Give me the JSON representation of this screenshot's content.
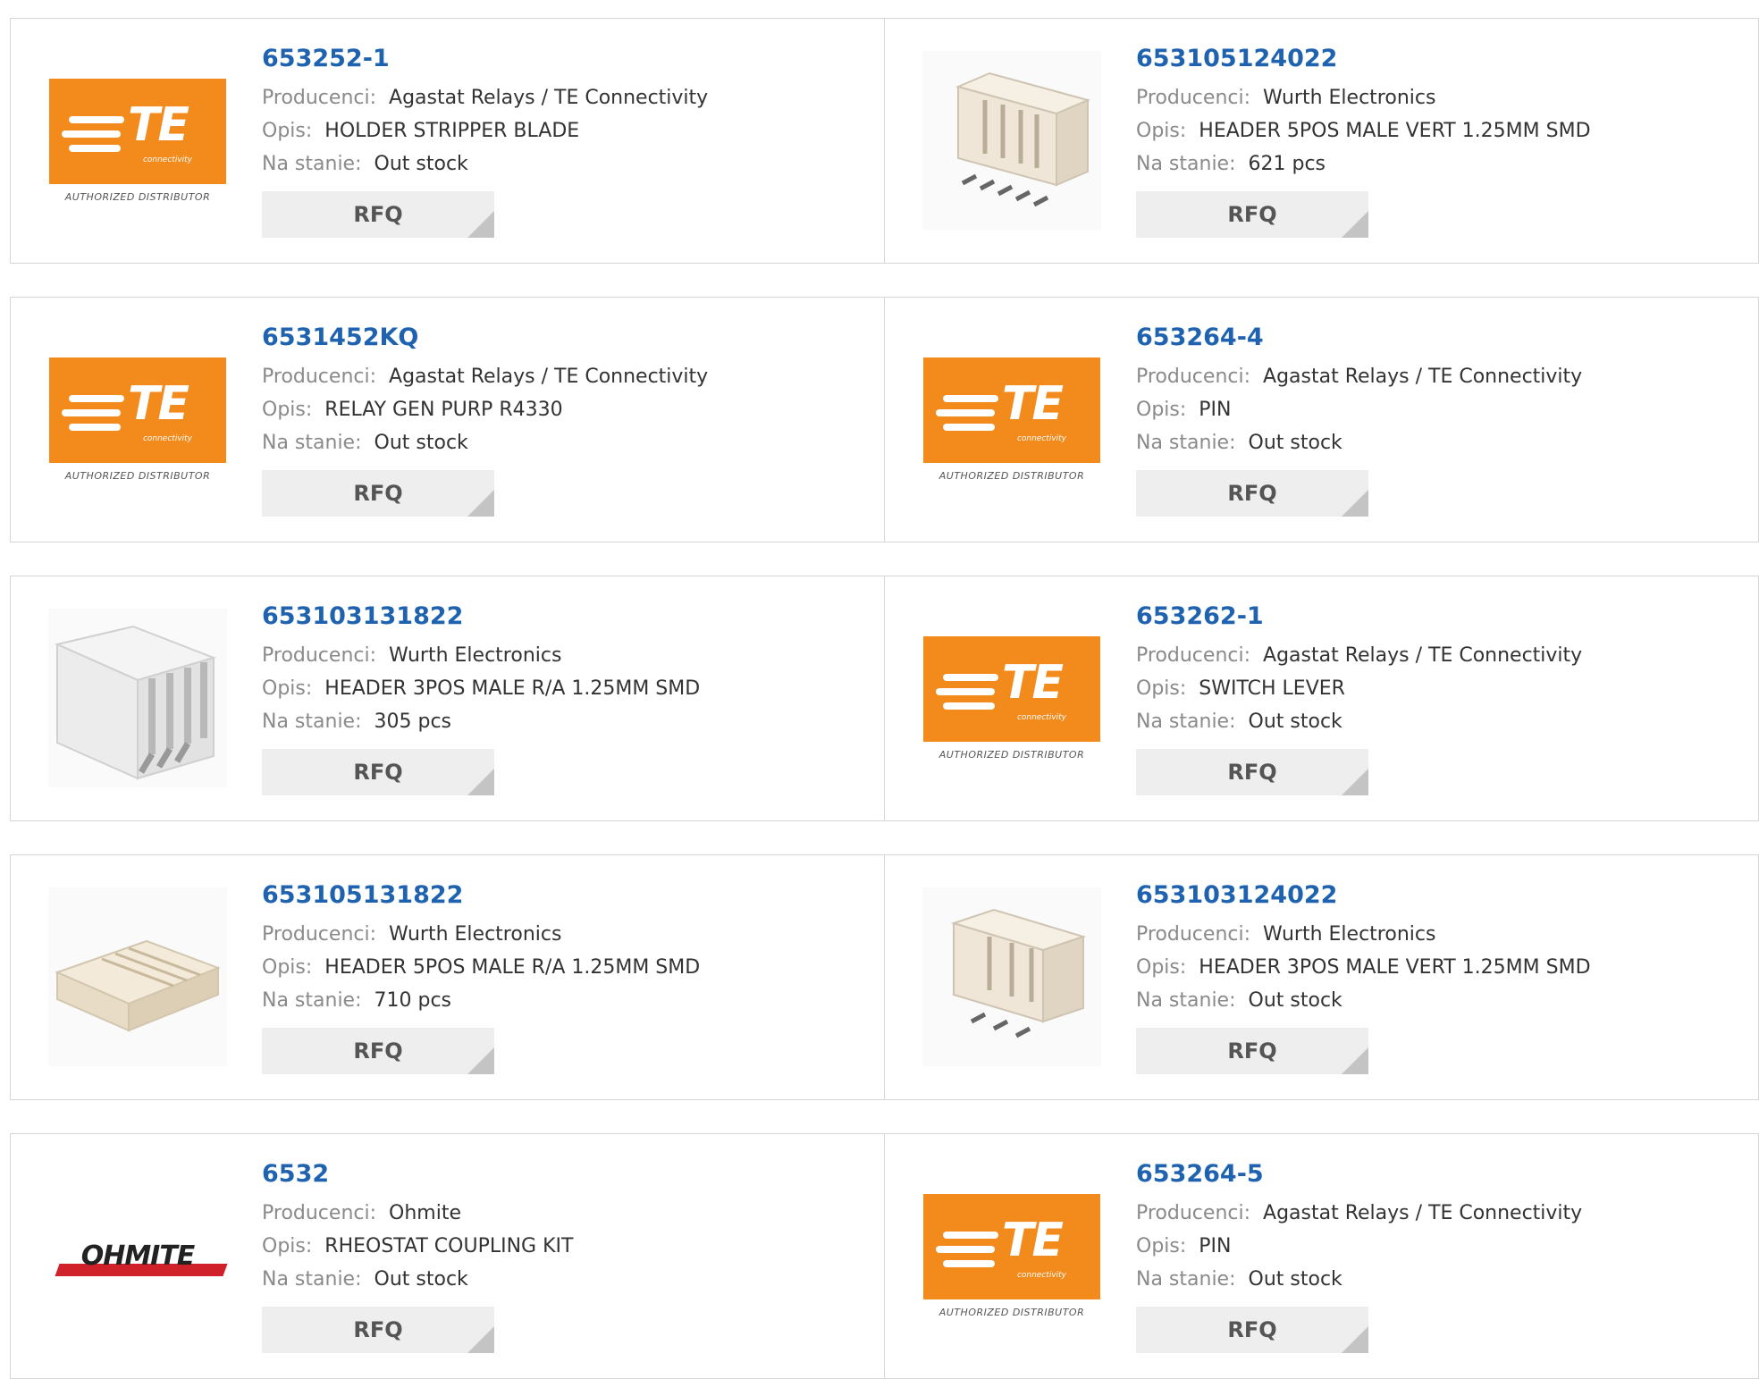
{
  "labels": {
    "manufacturer": "Producenci:",
    "description": "Opis:",
    "stock": "Na stanie:"
  },
  "logos": {
    "te_letters": "TE",
    "te_sub": "connectivity",
    "te_authorized": "AUTHORIZED DISTRIBUTOR",
    "ohmite": "OHMITE"
  },
  "products": [
    {
      "part": "653252-1",
      "manufacturer": "Agastat Relays / TE Connectivity",
      "description": "HOLDER STRIPPER BLADE",
      "stock": "Out stock",
      "button": "RFQ",
      "image": "te-logo"
    },
    {
      "part": "653105124022",
      "manufacturer": "Wurth Electronics",
      "description": "HEADER 5POS MALE VERT 1.25MM SMD",
      "stock": "621 pcs",
      "button": "RFQ",
      "image": "vertical-header-photo"
    },
    {
      "part": "6531452KQ",
      "manufacturer": "Agastat Relays / TE Connectivity",
      "description": "RELAY GEN PURP R4330",
      "stock": "Out stock",
      "button": "RFQ",
      "image": "te-logo"
    },
    {
      "part": "653264-4",
      "manufacturer": "Agastat Relays / TE Connectivity",
      "description": "PIN",
      "stock": "Out stock",
      "button": "RFQ",
      "image": "te-logo"
    },
    {
      "part": "653103131822",
      "manufacturer": "Wurth Electronics",
      "description": "HEADER 3POS MALE R/A 1.25MM SMD",
      "stock": "305 pcs",
      "button": "RFQ",
      "image": "right-angle-header-photo"
    },
    {
      "part": "653262-1",
      "manufacturer": "Agastat Relays / TE Connectivity",
      "description": "SWITCH LEVER",
      "stock": "Out stock",
      "button": "RFQ",
      "image": "te-logo"
    },
    {
      "part": "653105131822",
      "manufacturer": "Wurth Electronics",
      "description": "HEADER 5POS MALE R/A 1.25MM SMD",
      "stock": "710 pcs",
      "button": "RFQ",
      "image": "side-header-photo"
    },
    {
      "part": "653103124022",
      "manufacturer": "Wurth Electronics",
      "description": "HEADER 3POS MALE VERT 1.25MM SMD",
      "stock": "Out stock",
      "button": "RFQ",
      "image": "vertical-header-photo"
    },
    {
      "part": "6532",
      "manufacturer": "Ohmite",
      "description": "RHEOSTAT COUPLING KIT",
      "stock": "Out stock",
      "button": "RFQ",
      "image": "ohmite-logo"
    },
    {
      "part": "653264-5",
      "manufacturer": "Agastat Relays / TE Connectivity",
      "description": "PIN",
      "stock": "Out stock",
      "button": "RFQ",
      "image": "te-logo"
    }
  ],
  "colors": {
    "part_link": "#1f63b0",
    "te_orange": "#f28b1c",
    "ohmite_red": "#d0202a",
    "button_bg": "#eeeeee"
  }
}
